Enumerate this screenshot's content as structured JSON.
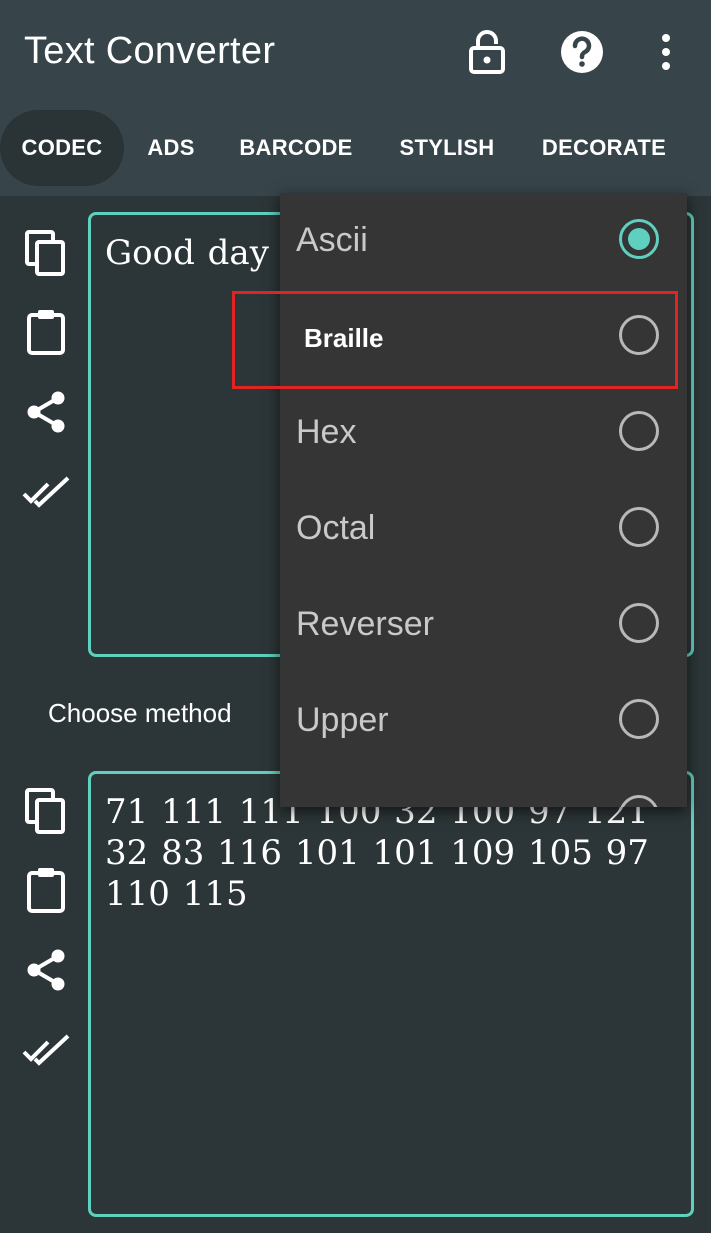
{
  "app": {
    "title": "Text Converter",
    "icons": [
      "lock-open-icon",
      "help-icon",
      "more-vert-icon"
    ]
  },
  "tabs": [
    {
      "label": "CODEC",
      "active": true
    },
    {
      "label": "ADS"
    },
    {
      "label": "BARCODE"
    },
    {
      "label": "STYLISH"
    },
    {
      "label": "DECORATE"
    }
  ],
  "input": {
    "value": "Good day"
  },
  "choose_label": "Choose method",
  "output": {
    "value": "71 111 111 100 32 100 97 121 32 83 116 101 101 109 105 97 110 115"
  },
  "methods": [
    {
      "label": "Ascii",
      "selected": true
    },
    {
      "label": "Braille",
      "selected": false
    },
    {
      "label": "Hex",
      "selected": false
    },
    {
      "label": "Octal",
      "selected": false
    },
    {
      "label": "Reverser",
      "selected": false
    },
    {
      "label": "Upper",
      "selected": false
    }
  ],
  "colors": {
    "accent": "#5fd0c0",
    "appbar": "#37454b",
    "background": "#2c3537",
    "highlight": "#e02424"
  }
}
